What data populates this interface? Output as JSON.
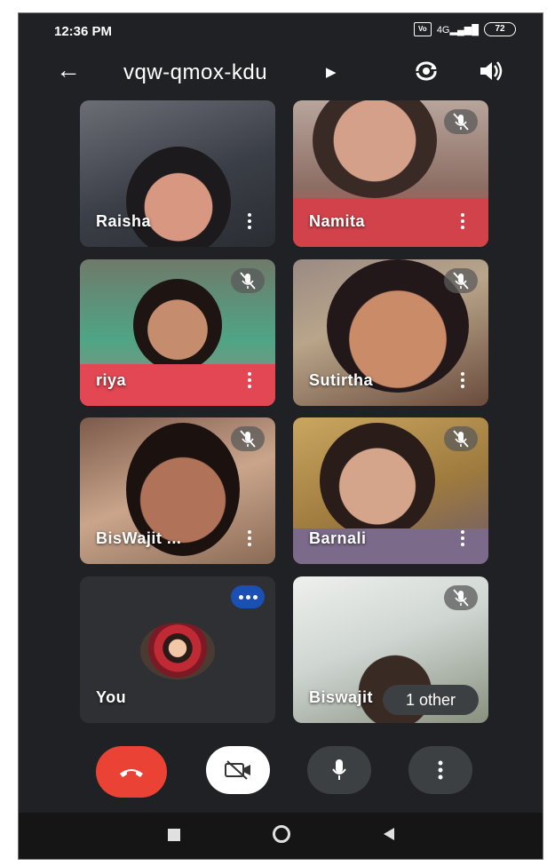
{
  "status_bar": {
    "time": "12:36 PM",
    "volte": "Vo LTE",
    "network": "4G",
    "battery": "72"
  },
  "header": {
    "meeting_code": "vqw-qmox-kdu"
  },
  "participants": [
    {
      "name": "Raisha",
      "muted": false
    },
    {
      "name": "Namita",
      "muted": true
    },
    {
      "name": "riya",
      "muted": true
    },
    {
      "name": "Sutirtha",
      "muted": true
    },
    {
      "name": "BisWajit ...",
      "muted": true
    },
    {
      "name": "Barnali",
      "muted": true
    },
    {
      "name": "You",
      "muted": false
    },
    {
      "name": "Biswajit",
      "muted": true
    }
  ],
  "others_chip": "1 other",
  "colors": {
    "end_call": "#ea4335",
    "badge": "#1a4fb3",
    "background": "#202124"
  },
  "icons": [
    "back-arrow-icon",
    "switch-camera-icon",
    "speaker-icon",
    "mic-off-icon",
    "more-vert-icon",
    "end-call-icon",
    "video-off-icon",
    "mic-icon",
    "recent-apps-icon",
    "home-icon",
    "back-nav-icon"
  ]
}
